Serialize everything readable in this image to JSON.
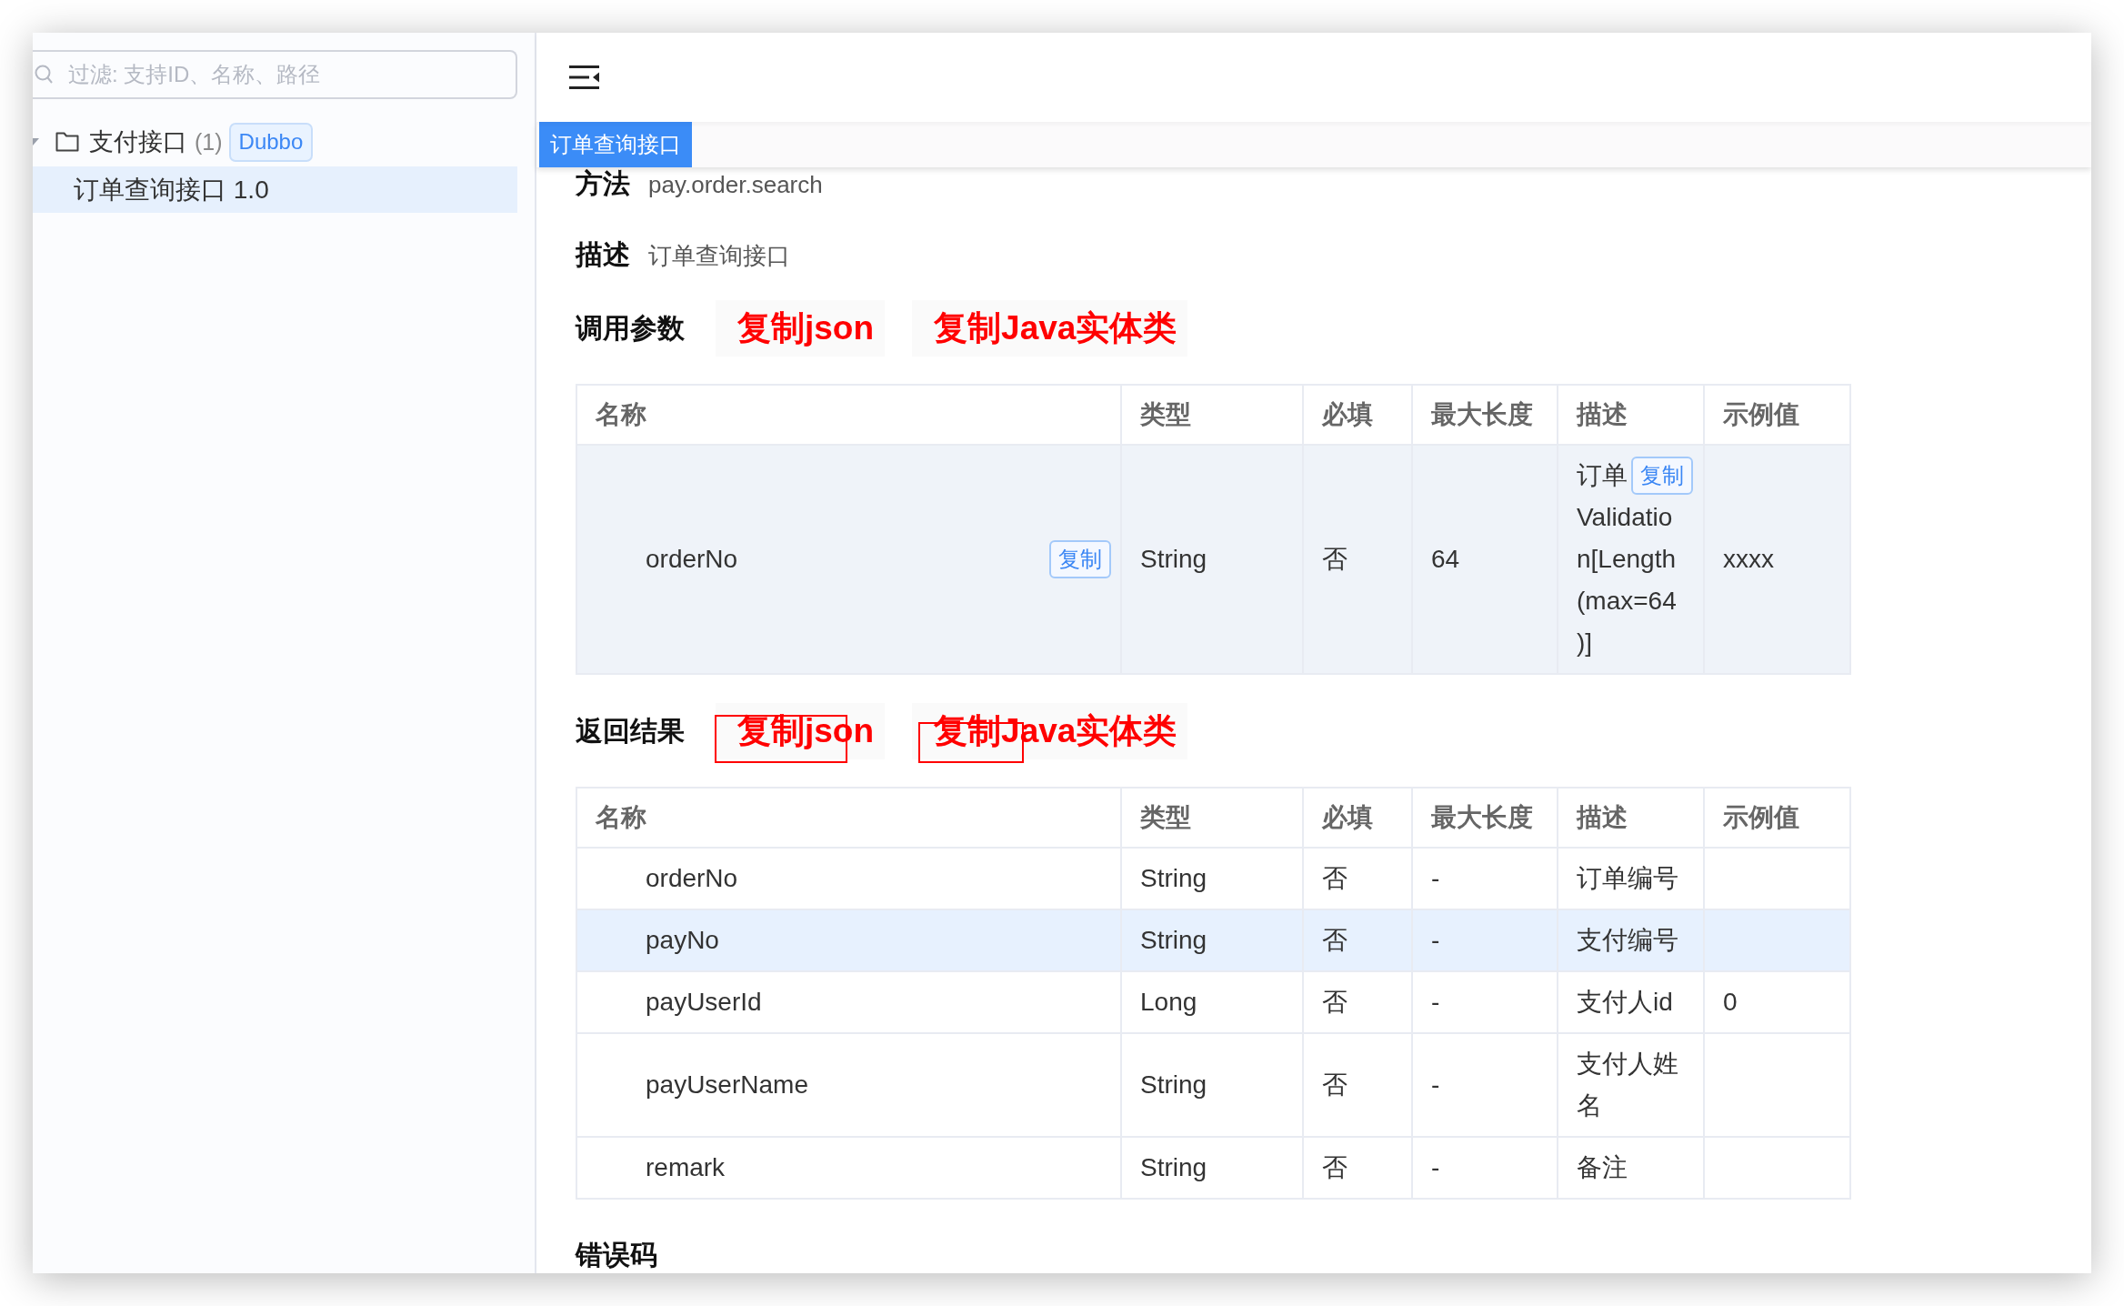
{
  "sidebar": {
    "search": {
      "placeholder": "过滤: 支持ID、名称、路径"
    },
    "tree": [
      {
        "label": "支付接口",
        "count": "(1)",
        "tag": "Dubbo",
        "expanded": true,
        "selected": false,
        "children": [
          {
            "label": "订单查询接口 1.0",
            "selected": true
          }
        ]
      }
    ]
  },
  "tabs": [
    {
      "label": "订单查询接口",
      "selected": true
    }
  ],
  "meta": [
    {
      "label": "方法",
      "value": "pay.order.search"
    },
    {
      "label": "描述",
      "value": "订单查询接口"
    }
  ],
  "sections": [
    {
      "title": "调用参数",
      "links": [
        {
          "label": "复制json",
          "boxed": false
        },
        {
          "label": "复制Java实体类",
          "boxed": false
        }
      ],
      "table": {
        "columns": [
          "名称",
          "类型",
          "必填",
          "最大长度",
          "描述",
          "示例值"
        ],
        "rows": [
          {
            "name": "orderNo",
            "copy": "复制",
            "type": "String",
            "required": "否",
            "max_length": "64",
            "description": "订单",
            "description_copy": "复制",
            "description_more": "Validation[Length(max=64)]",
            "example": "xxxx",
            "hovered": true
          }
        ]
      }
    },
    {
      "title": "返回结果",
      "links": [
        {
          "label": "复制json",
          "boxed": true
        },
        {
          "label": "复制Java实体类",
          "boxed": true
        }
      ],
      "table": {
        "columns": [
          "名称",
          "类型",
          "必填",
          "最大长度",
          "描述",
          "示例值"
        ],
        "rows": [
          {
            "name": "orderNo",
            "type": "String",
            "required": "否",
            "max_length": "-",
            "description": "订单编号",
            "selected": false
          },
          {
            "name": "payNo",
            "type": "String",
            "required": "否",
            "max_length": "-",
            "description": "支付编号",
            "selected": true
          },
          {
            "name": "payUserId",
            "type": "Long",
            "required": "否",
            "max_length": "-",
            "description": "支付人id",
            "example": "0",
            "selected": false
          },
          {
            "name": "payUserName",
            "type": "String",
            "required": "否",
            "max_length": "-",
            "description": "支付人姓名",
            "selected": false
          },
          {
            "name": "remark",
            "type": "String",
            "required": "否",
            "max_length": "-",
            "description": "备注",
            "selected": false
          }
        ]
      }
    }
  ],
  "error_codes": {
    "title": "错误码"
  }
}
